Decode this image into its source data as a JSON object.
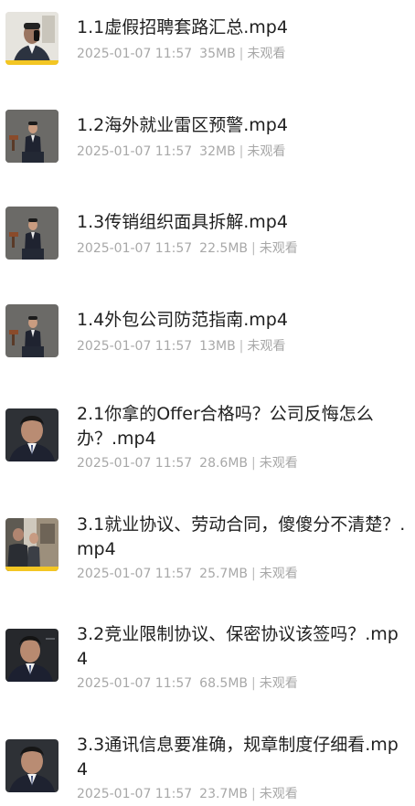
{
  "files": [
    {
      "title": "1.1虚假招聘套路汇总.mp4",
      "date": "2025-01-07 11:57",
      "size": "35MB",
      "status": "未观看",
      "thumb": "phone-call"
    },
    {
      "title": "1.2海外就业雷区预警.mp4",
      "date": "2025-01-07 11:57",
      "size": "32MB",
      "status": "未观看",
      "thumb": "studio-seated"
    },
    {
      "title": "1.3传销组织面具拆解.mp4",
      "date": "2025-01-07 11:57",
      "size": "22.5MB",
      "status": "未观看",
      "thumb": "studio-seated"
    },
    {
      "title": "1.4外包公司防范指南.mp4",
      "date": "2025-01-07 11:57",
      "size": "13MB",
      "status": "未观看",
      "thumb": "studio-seated"
    },
    {
      "title": "2.1你拿的Offer合格吗？公司反悔怎么办？.mp4",
      "date": "2025-01-07 11:57",
      "size": "28.6MB",
      "status": "未观看",
      "thumb": "closeup"
    },
    {
      "title": "3.1就业协议、劳动合同，傻傻分不清楚？.mp4",
      "date": "2025-01-07 11:57",
      "size": "25.7MB",
      "status": "未观看",
      "thumb": "scene"
    },
    {
      "title": "3.2竞业限制协议、保密协议该签吗？.mp4",
      "date": "2025-01-07 11:57",
      "size": "68.5MB",
      "status": "未观看",
      "thumb": "closeup-dark"
    },
    {
      "title": "3.3通讯信息要准确，规章制度仔细看.mp4",
      "date": "2025-01-07 11:57",
      "size": "23.7MB",
      "status": "未观看",
      "thumb": "closeup"
    }
  ],
  "colors": {
    "title": "#1f1f1f",
    "meta": "#a8a8a8",
    "thumb_border_yellow": "#f3c623"
  }
}
